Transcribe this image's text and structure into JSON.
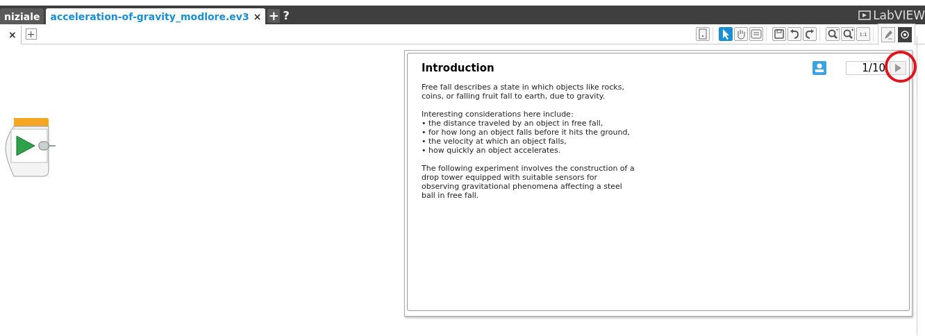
{
  "title_bar": {
    "tabs": [
      {
        "label": "niziale",
        "selected": false
      },
      {
        "label": "acceleration-of-gravity_modlore.ev3",
        "selected": true,
        "close": "×"
      }
    ],
    "add": "+",
    "help": "?",
    "logo": "LabVIEW"
  },
  "program_tabs": {
    "tabs": [
      {
        "close": "×",
        "selected": true
      }
    ],
    "add": "+"
  },
  "toolbar": {
    "groups": [
      [
        {
          "kind": "document",
          "selected": false
        }
      ],
      [
        {
          "kind": "pointer",
          "selected": true
        },
        {
          "kind": "hand",
          "selected": false
        },
        {
          "kind": "comment",
          "selected": false
        }
      ],
      [
        {
          "kind": "save",
          "selected": false
        },
        {
          "kind": "undo",
          "selected": false
        },
        {
          "kind": "redo",
          "selected": false
        }
      ],
      [
        {
          "kind": "zoom-out",
          "selected": false
        },
        {
          "kind": "zoom-in",
          "selected": false
        },
        {
          "kind": "zoom-reset",
          "label": "1:1",
          "selected": false
        }
      ]
    ]
  },
  "side_tabs": [
    {
      "kind": "pencil",
      "selected": false
    },
    {
      "kind": "eye",
      "selected": true
    }
  ],
  "content_panel": {
    "title": "Introduction",
    "page": "1/10",
    "highlight_next": true,
    "paragraphs": [
      "Free fall describes a state in which objects like rocks,\ncoins, or falling fruit fall to earth, due to gravity.",
      "Interesting considerations here include:\n• the distance traveled by an object in free fall,\n• for how long an object falls before it hits the ground,\n• the velocity at which an object falls,\n• how quickly an object accelerates.",
      "The following experiment involves the construction of a\ndrop tower equipped with suitable sensors for\nobserving gravitational phenomena affecting a steel\nball in free fall."
    ]
  }
}
